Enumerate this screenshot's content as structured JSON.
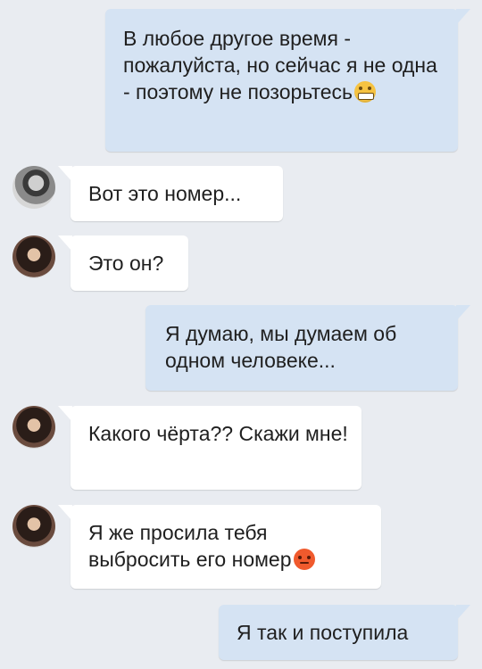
{
  "messages": [
    {
      "id": 1,
      "side": "out",
      "text": "В любое другое время - пожалуйста, но сейчас я не одна - поэтому не позорьтесь",
      "emoji": "grinning-face-icon"
    },
    {
      "id": 2,
      "side": "in",
      "sender": "male",
      "text": "Вот это номер..."
    },
    {
      "id": 3,
      "side": "in",
      "sender": "female",
      "text": "Это он?"
    },
    {
      "id": 4,
      "side": "out",
      "text": "Я думаю, мы думаем об одном человеке..."
    },
    {
      "id": 5,
      "side": "in",
      "sender": "female",
      "text": "Какого чёрта?? Скажи мне!"
    },
    {
      "id": 6,
      "side": "in",
      "sender": "female",
      "text": "Я же просила тебя выбросить его номер",
      "emoji": "angry-face-icon"
    },
    {
      "id": 7,
      "side": "out",
      "text": "Я так и поступила"
    }
  ],
  "colors": {
    "background": "#e9ecf1",
    "outgoing_bubble": "#d5e3f3",
    "incoming_bubble": "#ffffff"
  }
}
